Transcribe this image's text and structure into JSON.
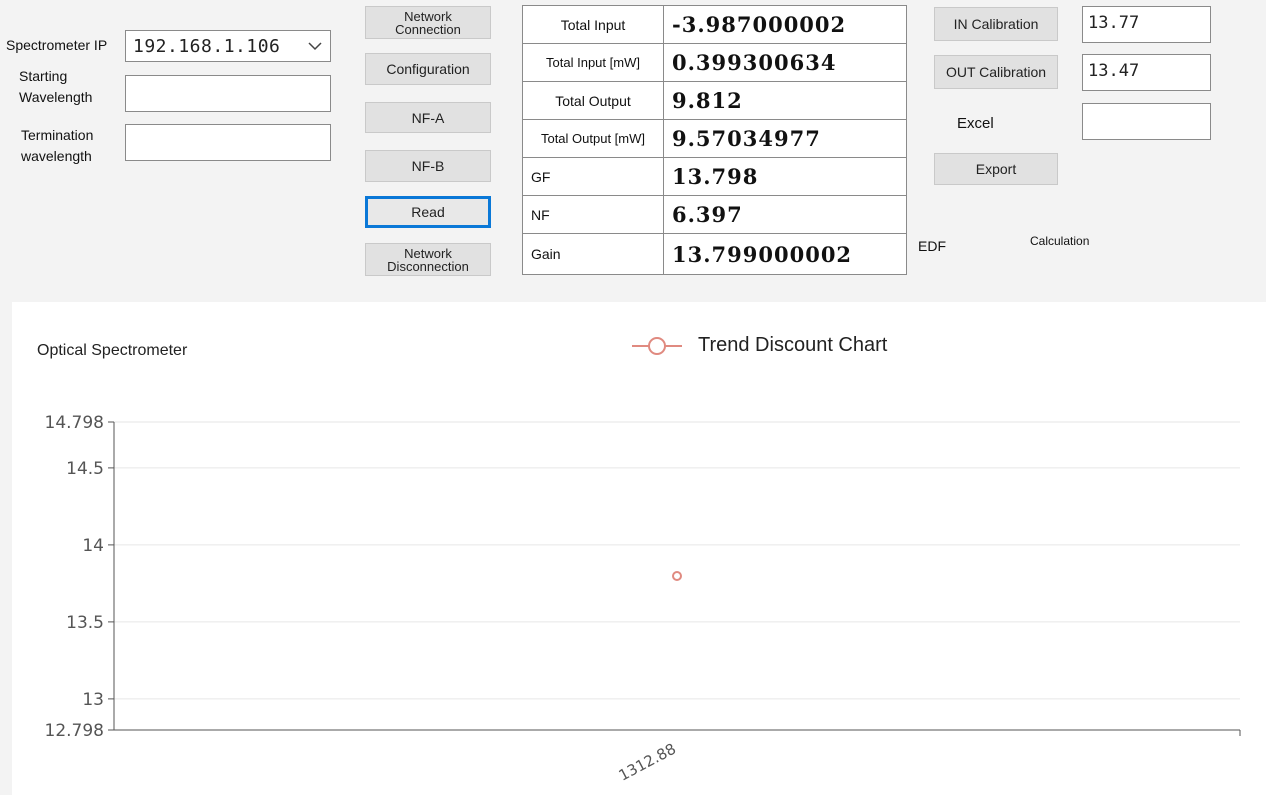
{
  "left_form": {
    "ip_label": "Spectrometer IP",
    "ip_value": "192.168.1.106",
    "start_label_line1": "Starting",
    "start_label_line2": "Wavelength",
    "start_value": "",
    "term_label_line1": "Termination",
    "term_label_line2": "wavelength",
    "term_value": ""
  },
  "buttons": {
    "network_connection_line1": "Network",
    "network_connection_line2": "Connection",
    "configuration": "Configuration",
    "nfa": "NF-A",
    "nfb": "NF-B",
    "read": "Read",
    "network_disconnection_line1": "Network",
    "network_disconnection_line2": "Disconnection"
  },
  "readings": [
    {
      "label": "Total Input",
      "value": "-3.987000002"
    },
    {
      "label": "Total Input [mW]",
      "value": "0.399300634"
    },
    {
      "label": "Total Output",
      "value": "9.812"
    },
    {
      "label": "Total Output [mW]",
      "value": "9.57034977"
    },
    {
      "label": "GF",
      "value": "13.798"
    },
    {
      "label": "NF",
      "value": "6.397"
    },
    {
      "label": "Gain",
      "value": "13.799000002"
    }
  ],
  "right_panel": {
    "in_calibration": "IN Calibration",
    "in_value": "13.77",
    "out_calibration": "OUT Calibration",
    "out_value": "13.47",
    "excel_label": "Excel",
    "excel_value": "",
    "export": "Export",
    "edf_label": "EDF",
    "calculation_label": "Calculation"
  },
  "chart": {
    "title": "Optical Spectrometer",
    "legend_label": "Trend Discount Chart"
  },
  "colors": {
    "series": "#e08a80",
    "focus": "#0a78d7"
  },
  "chart_data": {
    "type": "line",
    "title": "Optical Spectrometer",
    "series": [
      {
        "name": "Trend Discount Chart",
        "x": [
          "1312.88"
        ],
        "values": [
          13.798
        ]
      }
    ],
    "x": [
      "1312.88"
    ],
    "ylim": [
      12.798,
      14.798
    ],
    "yticks": [
      "12.798",
      "13",
      "13.5",
      "14",
      "14.5",
      "14.798"
    ],
    "xticks": [
      "1312.88"
    ],
    "grid": true,
    "legend_position": "top-center"
  }
}
